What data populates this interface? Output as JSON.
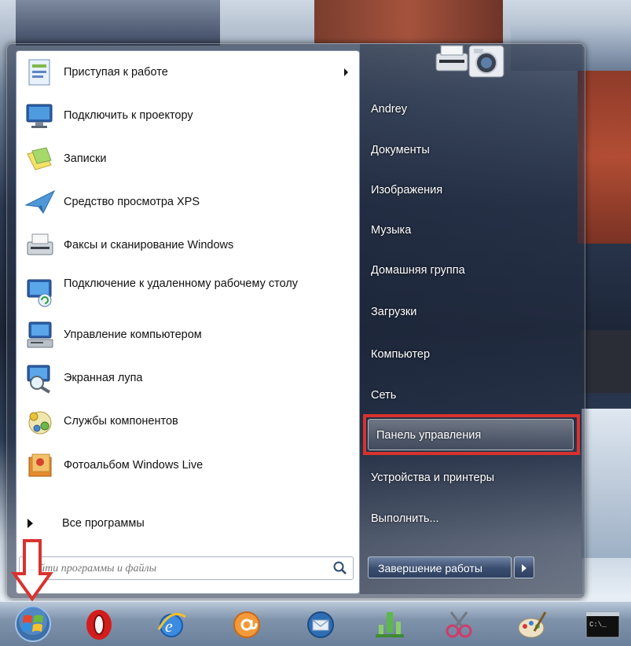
{
  "start_menu": {
    "programs": [
      {
        "label": "Приступая к работе",
        "icon": "getting-started-icon",
        "has_submenu": true
      },
      {
        "label": "Подключить к проектору",
        "icon": "projector-icon"
      },
      {
        "label": "Записки",
        "icon": "sticky-notes-icon"
      },
      {
        "label": "Средство просмотра XPS",
        "icon": "xps-viewer-icon"
      },
      {
        "label": "Факсы и сканирование Windows",
        "icon": "fax-scan-icon"
      },
      {
        "label": "Подключение к удаленному рабочему столу",
        "icon": "remote-desktop-icon"
      },
      {
        "label": "Управление компьютером",
        "icon": "computer-management-icon"
      },
      {
        "label": "Экранная лупа",
        "icon": "magnifier-icon"
      },
      {
        "label": "Службы компонентов",
        "icon": "component-services-icon"
      },
      {
        "label": "Фотоальбом Windows Live",
        "icon": "photo-gallery-icon"
      }
    ],
    "all_programs": "Все программы",
    "search_placeholder": "Найти программы и файлы",
    "right": {
      "user": "Andrey",
      "documents": "Документы",
      "pictures": "Изображения",
      "music": "Музыка",
      "homegroup": "Домашняя группа",
      "downloads": "Загрузки",
      "computer": "Компьютер",
      "network": "Сеть",
      "control_panel": "Панель управления",
      "devices": "Устройства и принтеры",
      "run": "Выполнить..."
    },
    "shutdown": "Завершение работы"
  },
  "taskbar": {
    "icons": [
      "windows-orb-icon",
      "opera-icon",
      "internet-explorer-icon",
      "mail-agent-icon",
      "thunderbird-icon",
      "network-tool-icon",
      "snipping-tool-icon",
      "paint-icon",
      "command-prompt-icon"
    ]
  },
  "colors": {
    "highlight_red": "#d9322e",
    "arrow_red": "#d9322e",
    "menu_white": "#ffffff"
  }
}
